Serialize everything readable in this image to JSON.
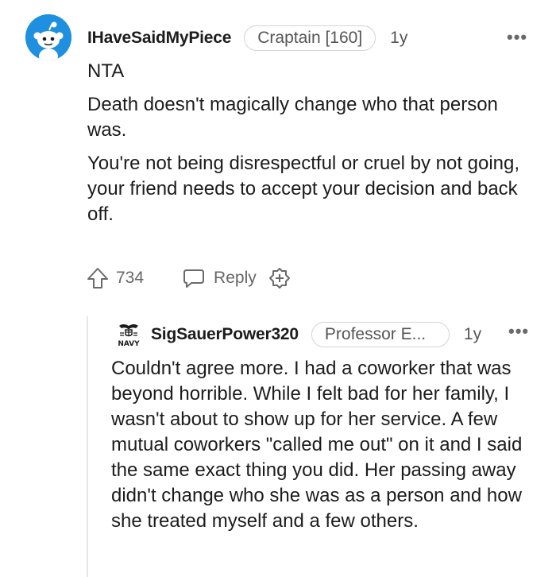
{
  "comment": {
    "username": "IHaveSaidMyPiece",
    "flair": "Craptain [160]",
    "age": "1y",
    "more_label": "•••",
    "avatar_icon": "reddit-snoo-avatar-icon",
    "paragraphs": [
      "NTA",
      "Death doesn't magically change who that person was.",
      "You're not being disrespectful or cruel by not going, your friend needs to accept your decision and back off."
    ],
    "actions": {
      "upvote_icon": "upvote-arrow-icon",
      "vote_count": "734",
      "reply_icon": "speech-bubble-icon",
      "reply_label": "Reply",
      "award_icon": "award-plus-icon"
    }
  },
  "reply": {
    "username": "SigSauerPower320",
    "flair": "Professor E...",
    "age": "1y",
    "more_label": "•••",
    "avatar_icon": "navy-emblem-avatar-icon",
    "avatar_text": "NAVY",
    "paragraphs": [
      "Couldn't agree more. I had a coworker that was beyond horrible. While I felt bad for her family, I wasn't about to show up for her service. A few mutual coworkers \"called me out\" on it and I said the same exact thing you did. Her passing away didn't change who she was as a person and how she treated myself and a few others."
    ]
  },
  "colors": {
    "text": "#1c1c1c",
    "muted": "#666666",
    "flair_border": "#d4d4d4",
    "avatar_blue": "#1f8fe0",
    "thread_line": "#e6e6e6"
  }
}
